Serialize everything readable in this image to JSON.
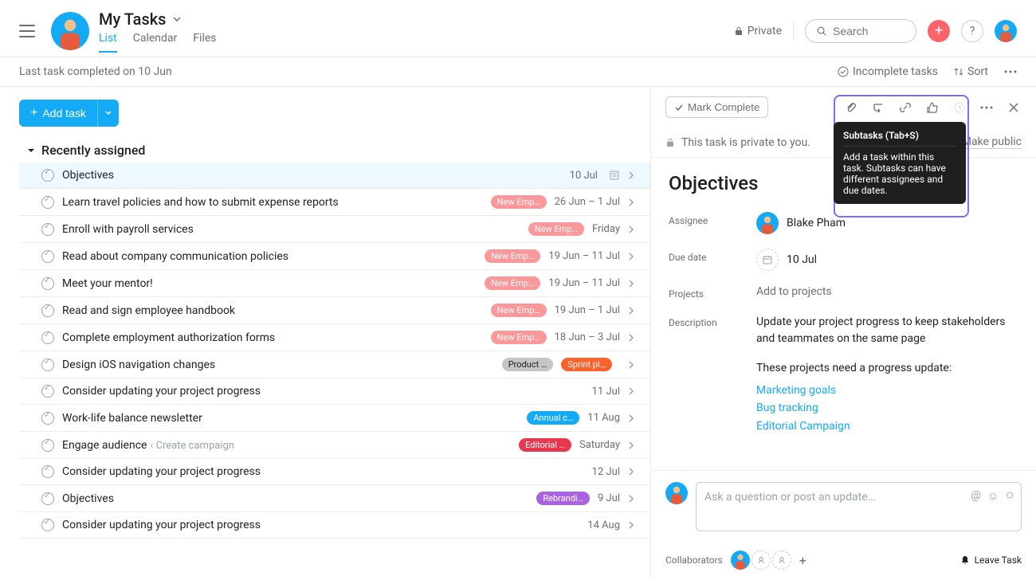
{
  "header": {
    "title": "My Tasks",
    "tabs": [
      "List",
      "Calendar",
      "Files"
    ],
    "active_tab": 0,
    "private_label": "Private",
    "search_placeholder": "Search"
  },
  "subbar": {
    "status": "Last task completed on 10 Jun",
    "filter": "Incomplete tasks",
    "sort": "Sort"
  },
  "list": {
    "add_task": "Add task",
    "section": "Recently assigned",
    "tasks": [
      {
        "name": "Objectives",
        "tags": [],
        "date": "10 Jul",
        "selected": true,
        "has_form": true
      },
      {
        "name": "Learn travel policies and how to submit expense reports",
        "tags": [
          {
            "text": "New Emp…",
            "color": "#fc979a"
          }
        ],
        "date": "26 Jun – 1 Jul"
      },
      {
        "name": "Enroll with payroll services",
        "tags": [
          {
            "text": "New Emp…",
            "color": "#fc979a"
          }
        ],
        "date": "Friday"
      },
      {
        "name": "Read about company communication policies",
        "tags": [
          {
            "text": "New Emp…",
            "color": "#fc979a"
          }
        ],
        "date": "19 Jun – 11 Jul"
      },
      {
        "name": "Meet your mentor!",
        "tags": [
          {
            "text": "New Emp…",
            "color": "#fc979a"
          }
        ],
        "date": "19 Jun – 11 Jul"
      },
      {
        "name": "Read and sign employee handbook",
        "tags": [
          {
            "text": "New Emp…",
            "color": "#fc979a"
          }
        ],
        "date": "19 Jun – 1 Jul"
      },
      {
        "name": "Complete employment authorization forms",
        "tags": [
          {
            "text": "New Emp…",
            "color": "#fc979a"
          }
        ],
        "date": "18 Jun – 3 Jul"
      },
      {
        "name": "Design iOS navigation changes",
        "tags": [
          {
            "text": "Product …",
            "color": "#c7c4c4",
            "fg": "#1e1f21"
          },
          {
            "text": "Sprint pl…",
            "color": "#fd612c"
          }
        ],
        "date": ""
      },
      {
        "name": "Consider updating your project progress",
        "tags": [],
        "date": "11 Jul"
      },
      {
        "name": "Work-life balance newsletter",
        "tags": [
          {
            "text": "Annual c…",
            "color": "#14aaf5"
          }
        ],
        "date": "11 Aug"
      },
      {
        "name": "Engage audience",
        "sub": "‹ Create campaign",
        "tags": [
          {
            "text": "Editorial …",
            "color": "#e8384f"
          }
        ],
        "date": "Saturday"
      },
      {
        "name": "Consider updating your project progress",
        "tags": [],
        "date": "12 Jul"
      },
      {
        "name": "Objectives",
        "tags": [
          {
            "text": "Rebrandi…",
            "color": "#aa62e3"
          }
        ],
        "date": "9 Jul"
      },
      {
        "name": "Consider updating your project progress",
        "tags": [],
        "date": "14 Aug"
      }
    ]
  },
  "detail": {
    "mark_complete": "Mark Complete",
    "privacy_text": "This task is private to you.",
    "make_public": "Make public",
    "title": "Objectives",
    "fields": {
      "assignee_label": "Assignee",
      "assignee_value": "Blake Pham",
      "due_label": "Due date",
      "due_value": "10 Jul",
      "projects_label": "Projects",
      "projects_value": "Add to projects",
      "description_label": "Description"
    },
    "description_p1": "Update your project progress to keep stakeholders and teammates on the same page",
    "description_p2": "These projects need a progress update:",
    "links": [
      "Marketing goals",
      "Bug tracking",
      "Editorial Campaign"
    ],
    "comment_placeholder": "Ask a question or post an update…",
    "collab_label": "Collaborators",
    "leave_task": "Leave Task"
  },
  "tooltip": {
    "title": "Subtasks (Tab+S)",
    "body": "Add a task within this task. Subtasks can have different assignees and due dates."
  }
}
